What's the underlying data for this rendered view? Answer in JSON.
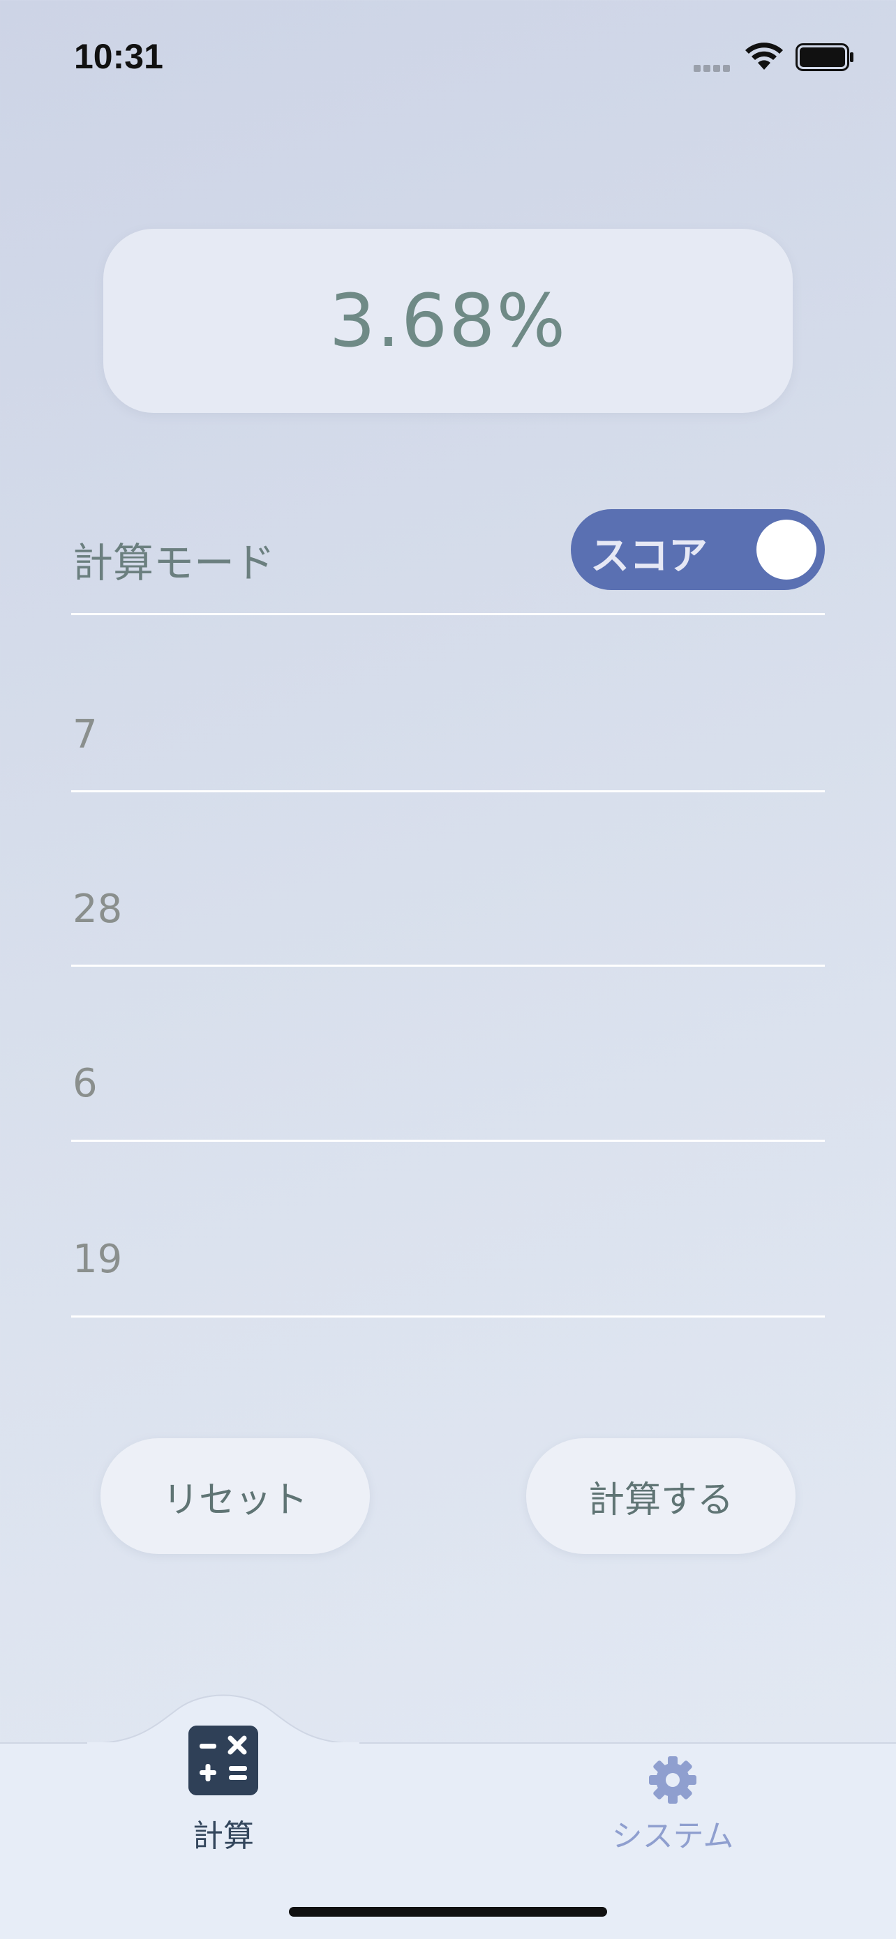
{
  "status_bar": {
    "time": "10:31"
  },
  "result": {
    "value": "3.68%"
  },
  "mode": {
    "label": "計算モード",
    "toggle_label": "スコア",
    "toggle_on": true
  },
  "inputs": [
    {
      "value": "7"
    },
    {
      "value": "28"
    },
    {
      "value": "6"
    },
    {
      "value": "19"
    }
  ],
  "buttons": {
    "reset_label": "リセット",
    "calculate_label": "計算する"
  },
  "tab_bar": {
    "tabs": [
      {
        "label": "計算",
        "icon": "calculator-icon",
        "active": true
      },
      {
        "label": "システム",
        "icon": "gear-icon",
        "active": false
      }
    ]
  },
  "colors": {
    "accent": "#5a70b2",
    "result_text": "#6f8a86",
    "active_tab": "#2f4057",
    "inactive_tab": "#8f9fcf"
  }
}
